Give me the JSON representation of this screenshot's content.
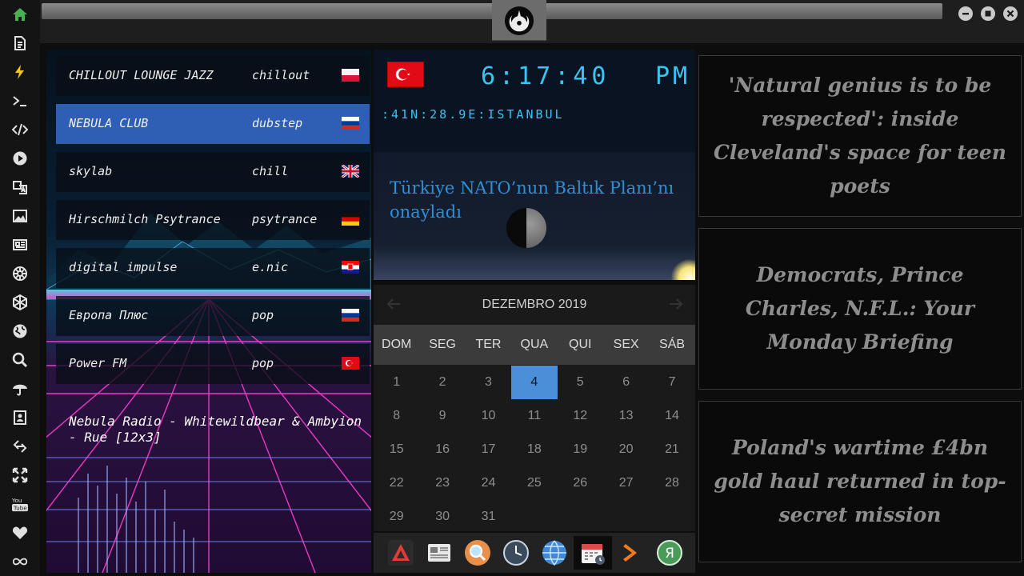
{
  "sidebar": {
    "items": [
      {
        "icon": "home-icon",
        "active": true
      },
      {
        "icon": "document-icon"
      },
      {
        "icon": "lightning-icon"
      },
      {
        "icon": "terminal-icon"
      },
      {
        "icon": "code-icon"
      },
      {
        "icon": "play-icon"
      },
      {
        "icon": "translate-icon"
      },
      {
        "icon": "image-icon"
      },
      {
        "icon": "newspaper-icon"
      },
      {
        "icon": "galactic-empire-icon"
      },
      {
        "icon": "hexagon-icon"
      },
      {
        "icon": "globe-icon"
      },
      {
        "icon": "search-icon"
      },
      {
        "icon": "umbrella-icon"
      },
      {
        "icon": "contact-icon"
      },
      {
        "icon": "link-icon"
      },
      {
        "icon": "expand-icon"
      },
      {
        "icon": "youtube-icon"
      },
      {
        "icon": "heart-icon"
      },
      {
        "icon": "infinity-icon"
      }
    ],
    "accent_color": "#4caf50",
    "highlight_color": "#f5c518"
  },
  "topbar": {
    "logo_icon": "rebel-alliance-icon",
    "window_buttons": [
      "minimize",
      "maximize",
      "close"
    ]
  },
  "radio": {
    "stations": [
      {
        "name": "CHILLOUT LOUNGE JAZZ",
        "genre": "chillout",
        "flag": "poland",
        "active": false
      },
      {
        "name": "NEBULA CLUB",
        "genre": "dubstep",
        "flag": "russia",
        "active": true
      },
      {
        "name": "skylab",
        "genre": "chill",
        "flag": "uk",
        "active": false
      },
      {
        "name": "Hirschmilch Psytrance",
        "genre": "psytrance",
        "flag": "germany",
        "active": false
      },
      {
        "name": "digital impulse",
        "genre": "e.nic",
        "flag": "croatia",
        "active": false
      },
      {
        "name": "Европа Плюс",
        "genre": "pop",
        "flag": "russia",
        "active": false
      },
      {
        "name": "Power FM",
        "genre": "pop",
        "flag": "turkey",
        "active": false
      }
    ],
    "now_playing": "Nebula Radio - Whitewildbear & Ambyion - Rue [12x3]",
    "active_color": "#2f5fb5"
  },
  "clock": {
    "flag": "turkey",
    "time": "6:17:40",
    "ampm": "PM",
    "location": ":41N:28.9E:ISTANBUL",
    "headline": "Türkiye NATO’nun Baltık Planı’nı onayladı",
    "color": "#39c5f2"
  },
  "calendar": {
    "title": "DEZEMBRO 2019",
    "weekdays": [
      "DOM",
      "SEG",
      "TER",
      "QUA",
      "QUI",
      "SEX",
      "SÁB"
    ],
    "days": [
      1,
      2,
      3,
      4,
      5,
      6,
      7,
      8,
      9,
      10,
      11,
      12,
      13,
      14,
      15,
      16,
      17,
      18,
      19,
      20,
      21,
      22,
      23,
      24,
      25,
      26,
      27,
      28,
      29,
      30,
      31
    ],
    "today": 4,
    "today_color": "#4a8fd7"
  },
  "dock": {
    "apps": [
      {
        "icon": "triangle-logo-icon"
      },
      {
        "icon": "news-reader-icon"
      },
      {
        "icon": "magnifier-icon"
      },
      {
        "icon": "clock-icon"
      },
      {
        "icon": "globe-icon"
      },
      {
        "icon": "calendar-icon",
        "active": true
      },
      {
        "icon": "chevron-play-icon"
      },
      {
        "icon": "yandex-icon"
      }
    ]
  },
  "news": [
    {
      "headline": "'Natural genius is to be respected': inside Cleveland's space for teen poets"
    },
    {
      "headline": "Democrats, Prince Charles, N.F.L.: Your Monday Briefing"
    },
    {
      "headline": "Poland's wartime £4bn gold haul returned in top-secret mission"
    }
  ]
}
